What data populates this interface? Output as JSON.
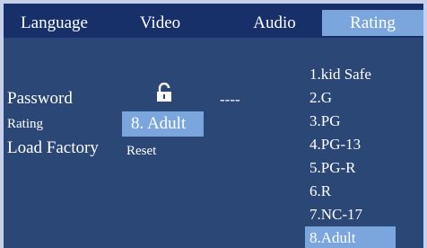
{
  "tabs": [
    {
      "label": "Language"
    },
    {
      "label": "Video"
    },
    {
      "label": "Audio"
    },
    {
      "label": "Rating",
      "active": true
    }
  ],
  "rows": {
    "password_label": "Password",
    "password_value": "----",
    "rating_label": "Rating",
    "rating_value": "8.  Adult",
    "load_factory_label": "Load Factory",
    "load_factory_value": "Reset"
  },
  "rating_options": [
    "1.kid Safe",
    "2.G",
    "3.PG",
    "4.PG-13",
    "5.PG-R",
    "6.R",
    "7.NC-17",
    "8.Adult"
  ],
  "selected_option_index": 7,
  "icons": {
    "lock": "unlocked-padlock-icon"
  },
  "colors": {
    "background": "#2b4776",
    "tab_bar": "#17306a",
    "highlight": "#7aa6dd",
    "frame": "#c7d0ea",
    "text": "#ffffff"
  }
}
